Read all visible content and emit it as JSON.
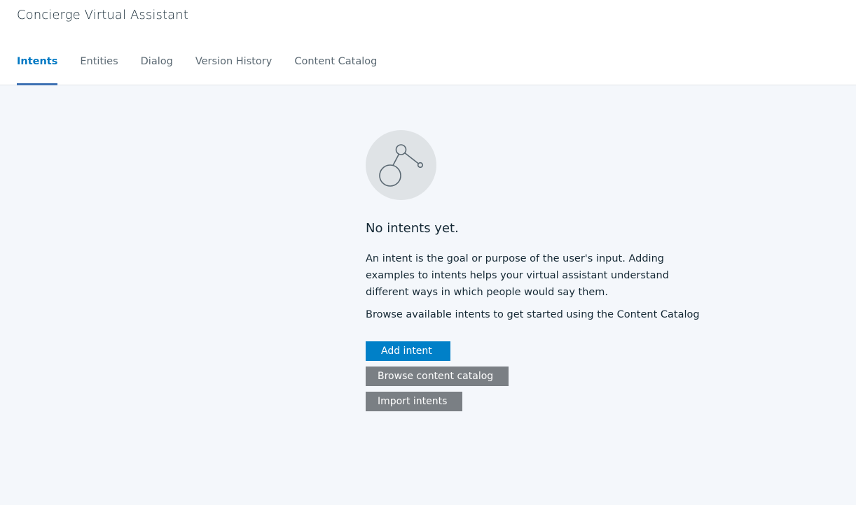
{
  "header": {
    "app_title": "Concierge Virtual Assistant"
  },
  "tabs": [
    {
      "label": "Intents",
      "active": true
    },
    {
      "label": "Entities",
      "active": false
    },
    {
      "label": "Dialog",
      "active": false
    },
    {
      "label": "Version History",
      "active": false
    },
    {
      "label": "Content Catalog",
      "active": false
    }
  ],
  "empty_state": {
    "icon": "intent-graph-icon",
    "title": "No intents yet.",
    "description": "An intent is the goal or purpose of the user's input. Adding examples to intents helps your virtual assistant understand different ways in which people would say them.",
    "browse_text": "Browse available intents to get started using the Content Catalog",
    "buttons": {
      "add": "Add intent",
      "browse": "Browse content catalog",
      "import": "Import intents"
    }
  },
  "colors": {
    "accent": "#0078c3",
    "primary_button": "#0080c8",
    "secondary_button": "#7a7f84",
    "background": "#f4f7fb"
  }
}
